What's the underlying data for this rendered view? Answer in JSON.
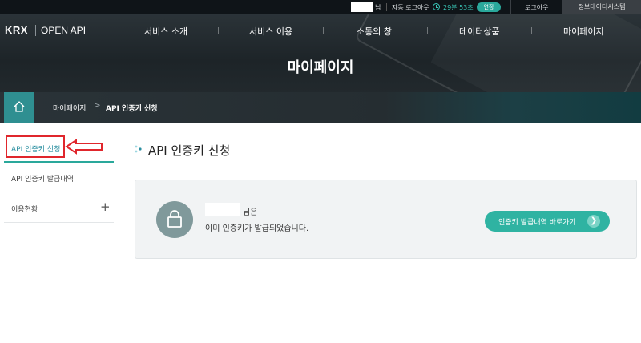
{
  "topbar": {
    "name_suffix": "님",
    "auto_logout_label": "자동 로그아웃",
    "timer": "29분 53초",
    "extend_label": "연장",
    "logout_label": "로그아웃",
    "data_system_label": "정보데이터시스템"
  },
  "header": {
    "logo": "KRX",
    "service_name": "OPEN API",
    "nav": [
      "서비스 소개",
      "서비스 이용",
      "소통의 창",
      "데이터상품",
      "마이페이지"
    ],
    "page_title": "마이페이지"
  },
  "breadcrumb": {
    "home_icon": "home-icon",
    "items": [
      "마이페이지",
      "API 인증키 신청"
    ]
  },
  "sidebar": {
    "items": [
      {
        "label": "API 인증키 신청",
        "active": true
      },
      {
        "label": "API 인증키 발급내역"
      },
      {
        "label": "이용현황",
        "expand_icon": "plus-icon"
      }
    ]
  },
  "main": {
    "title": "API 인증키 신청",
    "panel": {
      "icon": "lock-icon",
      "user_suffix": "님은",
      "message": "이미 인증키가 발급되었습니다.",
      "button_label": "인증키 발급내역 바로가기",
      "button_icon": "chevron-right-icon"
    }
  },
  "colors": {
    "accent": "#2fb3a2",
    "annotation_red": "#e0262c",
    "header_dark": "#1d2428"
  }
}
